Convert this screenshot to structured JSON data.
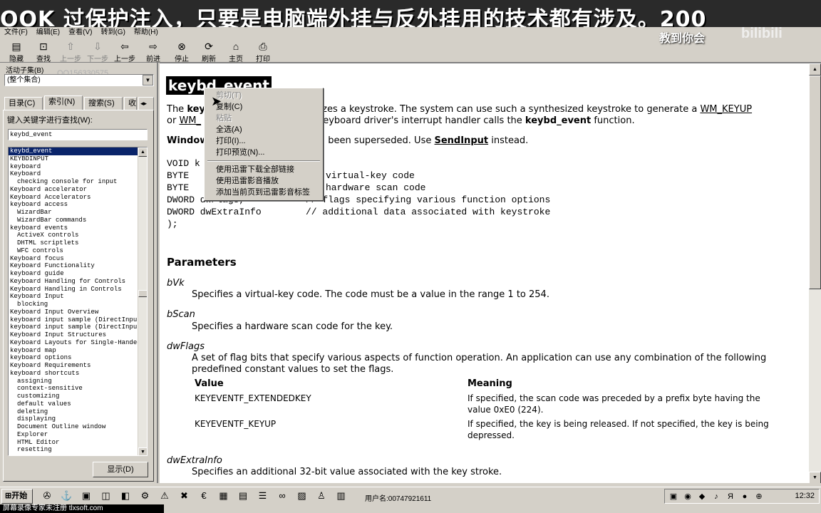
{
  "banner": {
    "text": "OOK 过保护注入，只要是电脑端外挂与反外挂用的技术都有涉及。200",
    "subtitle": "教到你会",
    "logo": "bilibili"
  },
  "menu": [
    "文件(F)",
    "编辑(E)",
    "查看(V)",
    "转到(G)",
    "帮助(H)"
  ],
  "toolbar": [
    {
      "label": "隐藏",
      "icon": "hide-icon"
    },
    {
      "label": "查找",
      "icon": "locate-icon"
    },
    {
      "label": "上一步",
      "icon": "up-arrow-icon",
      "disabled": true
    },
    {
      "label": "下一步",
      "icon": "down-arrow-icon",
      "disabled": true
    },
    {
      "label": "上一步",
      "icon": "back-icon"
    },
    {
      "label": "前进",
      "icon": "forward-icon"
    },
    {
      "label": "停止",
      "icon": "stop-icon"
    },
    {
      "label": "刷新",
      "icon": "refresh-icon"
    },
    {
      "label": "主页",
      "icon": "home-icon"
    },
    {
      "label": "打印",
      "icon": "print-icon"
    }
  ],
  "left": {
    "subset_label": "活动子集(B)",
    "subset_watermark": "QQ156330575",
    "subset_value": "(整个集合)",
    "tabs": [
      "目录(C)",
      "索引(N)",
      "搜索(S)",
      "收"
    ],
    "keyword_label": "键入关键字进行查找(W):",
    "keyword_value": "keybd_event",
    "items": [
      {
        "t": "keybd_event",
        "sel": true
      },
      {
        "t": "KEYBDINPUT"
      },
      {
        "t": "keyboard"
      },
      {
        "t": "Keyboard"
      },
      {
        "t": "checking console for input",
        "sub": true
      },
      {
        "t": "Keyboard accelerator"
      },
      {
        "t": "Keyboard Accelerators"
      },
      {
        "t": "keyboard access"
      },
      {
        "t": "WizardBar",
        "sub": true
      },
      {
        "t": "WizardBar commands",
        "sub": true
      },
      {
        "t": "keyboard events"
      },
      {
        "t": "ActiveX controls",
        "sub": true
      },
      {
        "t": "DHTML scriptlets",
        "sub": true
      },
      {
        "t": "WFC controls",
        "sub": true
      },
      {
        "t": "Keyboard focus"
      },
      {
        "t": "Keyboard Functionality"
      },
      {
        "t": "keyboard guide"
      },
      {
        "t": "Keyboard Handling for Controls"
      },
      {
        "t": "Keyboard Handling in Controls"
      },
      {
        "t": "Keyboard Input"
      },
      {
        "t": "blocking",
        "sub": true
      },
      {
        "t": "Keyboard Input Overview"
      },
      {
        "t": "keyboard input sample (DirectInput"
      },
      {
        "t": "keyboard input sample (DirectInput"
      },
      {
        "t": "Keyboard Input Structures"
      },
      {
        "t": "Keyboard Layouts for Single-Handed"
      },
      {
        "t": "keyboard map"
      },
      {
        "t": "keyboard options"
      },
      {
        "t": "Keyboard Requirements"
      },
      {
        "t": "keyboard shortcuts"
      },
      {
        "t": "assigning",
        "sub": true
      },
      {
        "t": "context-sensitive",
        "sub": true
      },
      {
        "t": "customizing",
        "sub": true
      },
      {
        "t": "default values",
        "sub": true
      },
      {
        "t": "deleting",
        "sub": true
      },
      {
        "t": "displaying",
        "sub": true
      },
      {
        "t": "Document Outline window",
        "sub": true
      },
      {
        "t": "Explorer",
        "sub": true
      },
      {
        "t": "HTML Editor",
        "sub": true
      },
      {
        "t": "resetting",
        "sub": true
      }
    ],
    "display_button": "显示(D)"
  },
  "content": {
    "title": "keybd_event",
    "intro1_a": "The ",
    "intro1_b": "keyb",
    "intro1_c": "nthesizes a keystroke. The system can use such a synthesized keystroke to generate a ",
    "intro1_link": "WM_KEYUP",
    "intro2_a": "or ",
    "intro2_link": "WM_",
    "intro2_b": " keyboard driver's interrupt handler calls the ",
    "intro2_bold": "keybd_event",
    "intro2_c": " function.",
    "note_a": "Window",
    "note_b": "been superseded. Use ",
    "note_link": "SendInput",
    "note_c": " instead.",
    "code": [
      "VOID k",
      "  BYTE",
      "  BYTE",
      "  DWORD dwFlags,",
      "  DWORD dwExtraInfo",
      ");"
    ],
    "code_comments": [
      "",
      "virtual-key code",
      "hardware scan code",
      "// flags specifying various function options",
      "// additional data associated with keystroke",
      ""
    ],
    "params_heading": "Parameters",
    "params": [
      {
        "name": "bVk",
        "desc": "Specifies a virtual-key code. The code must be a value in the range 1 to 254."
      },
      {
        "name": "bScan",
        "desc": "Specifies a hardware scan code for the key."
      },
      {
        "name": "dwFlags",
        "desc": "A set of flag bits that specify various aspects of function operation. An application can use any combination of the following",
        "desc2": "predefined constant values to set the flags."
      },
      {
        "name": "dwExtraInfo",
        "desc": "Specifies an additional 32-bit value associated with the key stroke."
      }
    ],
    "table": {
      "headers": [
        "Value",
        "Meaning"
      ],
      "rows": [
        {
          "value": "KEYEVENTF_EXTENDEDKEY",
          "m1": "If specified, the scan code was preceded by a prefix byte having the",
          "m2": "value 0xE0 (224)."
        },
        {
          "value": "KEYEVENTF_KEYUP",
          "m1": "If specified, the key is being released. If not specified, the key is being",
          "m2": "depressed."
        }
      ]
    }
  },
  "context_menu": [
    {
      "label": "剪切(T)",
      "disabled": true
    },
    {
      "label": "复制(C)"
    },
    {
      "label": "粘贴",
      "disabled": true
    },
    {
      "label": "全选(A)"
    },
    {
      "label": "打印(I)..."
    },
    {
      "label": "打印预览(N)..."
    },
    {
      "sep": true
    },
    {
      "label": "使用迅雷下载全部链接"
    },
    {
      "label": "使用迅雷影音播放"
    },
    {
      "label": "添加当前页到迅雷影音标签"
    }
  ],
  "taskbar": {
    "start": "开始",
    "user": "用户名:00747921611",
    "clock": "12:32"
  },
  "footer": "屏幕录像专家未注册 tlxsoft.com"
}
